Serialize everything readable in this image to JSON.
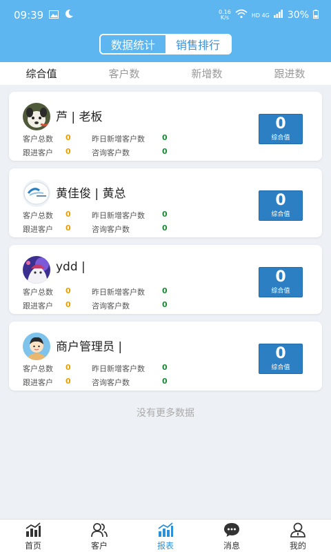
{
  "status_bar": {
    "time": "09:39",
    "speed": "0.16",
    "speed_unit": "K/s",
    "network": "HD 4G",
    "battery": "30%"
  },
  "header": {
    "tabs": [
      {
        "label": "数据统计",
        "active": true
      },
      {
        "label": "销售排行",
        "active": false
      }
    ]
  },
  "sort_tabs": [
    {
      "label": "综合值",
      "active": true
    },
    {
      "label": "客户数"
    },
    {
      "label": "新增数"
    },
    {
      "label": "跟进数"
    }
  ],
  "labels": {
    "total_customers": "客户总数",
    "new_yesterday": "昨日新增客户数",
    "follow_up": "跟进客户",
    "inquiry": "咨询客户数",
    "score_caption": "综合值"
  },
  "cards": [
    {
      "name": "芦 | 老板",
      "avatar": "dog-avatar",
      "total_customers": "0",
      "new_yesterday": "0",
      "follow_up": "0",
      "inquiry": "0",
      "score": "0"
    },
    {
      "name": "黄佳俊 | 黄总",
      "avatar": "logo-avatar",
      "total_customers": "0",
      "new_yesterday": "0",
      "follow_up": "0",
      "inquiry": "0",
      "score": "0"
    },
    {
      "name": "ydd |",
      "avatar": "anime-avatar",
      "total_customers": "0",
      "new_yesterday": "0",
      "follow_up": "0",
      "inquiry": "0",
      "score": "0"
    },
    {
      "name": "商户管理员 |",
      "avatar": "cartoon-person-avatar",
      "total_customers": "0",
      "new_yesterday": "0",
      "follow_up": "0",
      "inquiry": "0",
      "score": "0"
    }
  ],
  "no_more": "没有更多数据",
  "bottom_nav": [
    {
      "label": "首页",
      "icon": "bar-chart-icon"
    },
    {
      "label": "客户",
      "icon": "customers-icon"
    },
    {
      "label": "报表",
      "icon": "report-icon",
      "active": true
    },
    {
      "label": "消息",
      "icon": "message-icon"
    },
    {
      "label": "我的",
      "icon": "profile-icon"
    }
  ],
  "colors": {
    "header": "#5db6f0",
    "score_box": "#2d7fc4",
    "accent": "#2d8fd8",
    "yellow_value": "#e6a000",
    "green_value": "#1a8a3a"
  }
}
